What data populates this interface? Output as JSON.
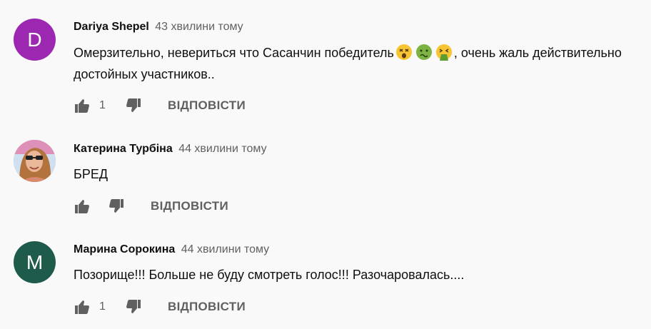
{
  "comments": [
    {
      "author": "Dariya Shepel",
      "time": "43 хвилини тому",
      "avatar_letter": "D",
      "avatar_color": "#9c27b0",
      "text_before": "Омерзительно, невериться что Сасанчин победитель",
      "emojis": [
        "dizzy-face-emoji",
        "nauseated-face-emoji",
        "vomiting-face-emoji"
      ],
      "text_after": ", очень жаль действительно достойных участников..",
      "likes": "1",
      "reply_label": "ВІДПОВІСТИ"
    },
    {
      "author": "Катерина Турбіна",
      "time": "44 хвилини тому",
      "avatar_letter": "",
      "avatar_color": "#d9a58b",
      "text": "БРЕД",
      "likes": "",
      "reply_label": "ВІДПОВІСТИ"
    },
    {
      "author": "Марина Сорокина",
      "time": "44 хвилини тому",
      "avatar_letter": "M",
      "avatar_color": "#1f5b4a",
      "text": "Позорище!!! Больше не буду смотреть голос!!! Разочаровалась....",
      "likes": "1",
      "reply_label": "ВІДПОВІСТИ"
    }
  ]
}
